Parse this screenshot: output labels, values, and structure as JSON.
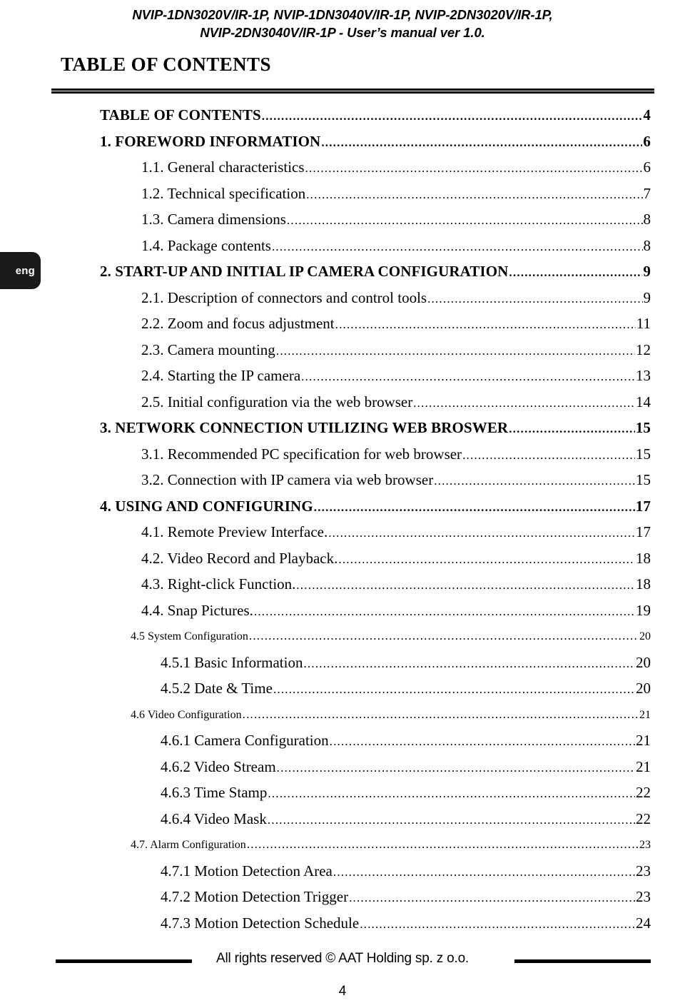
{
  "header": {
    "line1": "NVIP-1DN3020V/IR-1P, NVIP-1DN3040V/IR-1P, NVIP-2DN3020V/IR-1P,",
    "line2": "NVIP-2DN3040V/IR-1P - User’s manual ver 1.0."
  },
  "lang_tab": {
    "label": "eng"
  },
  "page_title": "TABLE OF CONTENTS",
  "toc": {
    "dot_leader": "..................................................................................................................................................",
    "entries": [
      {
        "label": "TABLE OF CONTENTS",
        "page": "4",
        "level": 1
      },
      {
        "label": "1. FOREWORD INFORMATION",
        "page": "6",
        "level": 1
      },
      {
        "label": "1.1. General characteristics",
        "page": "6",
        "level": 2
      },
      {
        "label": "1.2. Technical specification ",
        "page": "7",
        "level": 2
      },
      {
        "label": "1.3. Camera dimensions ",
        "page": "8",
        "level": 2
      },
      {
        "label": "1.4. Package contents",
        "page": "8",
        "level": 2
      },
      {
        "label": "2. START-UP AND INITIAL IP CAMERA CONFIGURATION ",
        "page": "9",
        "level": 1
      },
      {
        "label": "2.1. Description of connectors and control tools",
        "page": "9",
        "level": 2
      },
      {
        "label": "2.2. Zoom and focus adjustment",
        "page": "11",
        "level": 2
      },
      {
        "label": "2.3. Camera mounting ",
        "page": "12",
        "level": 2
      },
      {
        "label": "2.4. Starting the IP camera",
        "page": "13",
        "level": 2
      },
      {
        "label": "2.5. Initial configuration via the web browser",
        "page": "14",
        "level": 2
      },
      {
        "label": "3. NETWORK CONNECTION UTILIZING WEB BROSWER ",
        "page": "15",
        "level": 1
      },
      {
        "label": "3.1. Recommended PC specification for web browser ",
        "page": "15",
        "level": 2
      },
      {
        "label": "3.2. Connection with IP camera via web browser",
        "page": "15",
        "level": 2
      },
      {
        "label": "4. USING AND CONFIGURING",
        "page": "17",
        "level": 1
      },
      {
        "label": "4.1. Remote Preview Interface. ",
        "page": "17",
        "level": 2
      },
      {
        "label": "4.2. Video Record and Playback. ",
        "page": "18",
        "level": 2
      },
      {
        "label": "4.3. Right-click Function.",
        "page": "18",
        "level": 2
      },
      {
        "label": "4.4. Snap Pictures. ",
        "page": "19",
        "level": 2
      },
      {
        "label": "4.5 System Configuration",
        "page": "20",
        "level": "2b"
      },
      {
        "label": "4.5.1 Basic Information",
        "page": "20",
        "level": 3
      },
      {
        "label": "4.5.2 Date & Time",
        "page": "20",
        "level": 3
      },
      {
        "label": "4.6 Video Configuration",
        "page": "21",
        "level": "2b"
      },
      {
        "label": "4.6.1 Camera Configuration",
        "page": "21",
        "level": 3
      },
      {
        "label": "4.6.2 Video Stream",
        "page": "21",
        "level": 3
      },
      {
        "label": "4.6.3 Time Stamp",
        "page": "22",
        "level": 3
      },
      {
        "label": "4.6.4 Video Mask ",
        "page": "22",
        "level": 3
      },
      {
        "label": "4.7. Alarm Configuration ",
        "page": "23",
        "level": "2b"
      },
      {
        "label": "4.7.1 Motion Detection Area",
        "page": "23",
        "level": 3
      },
      {
        "label": "4.7.2 Motion Detection Trigger ",
        "page": "23",
        "level": 3
      },
      {
        "label": "4.7.3 Motion Detection Schedule",
        "page": "24",
        "level": 3
      }
    ]
  },
  "footer": {
    "copyright": "All rights reserved © AAT Holding sp. z o.o.",
    "page_number": "4"
  }
}
